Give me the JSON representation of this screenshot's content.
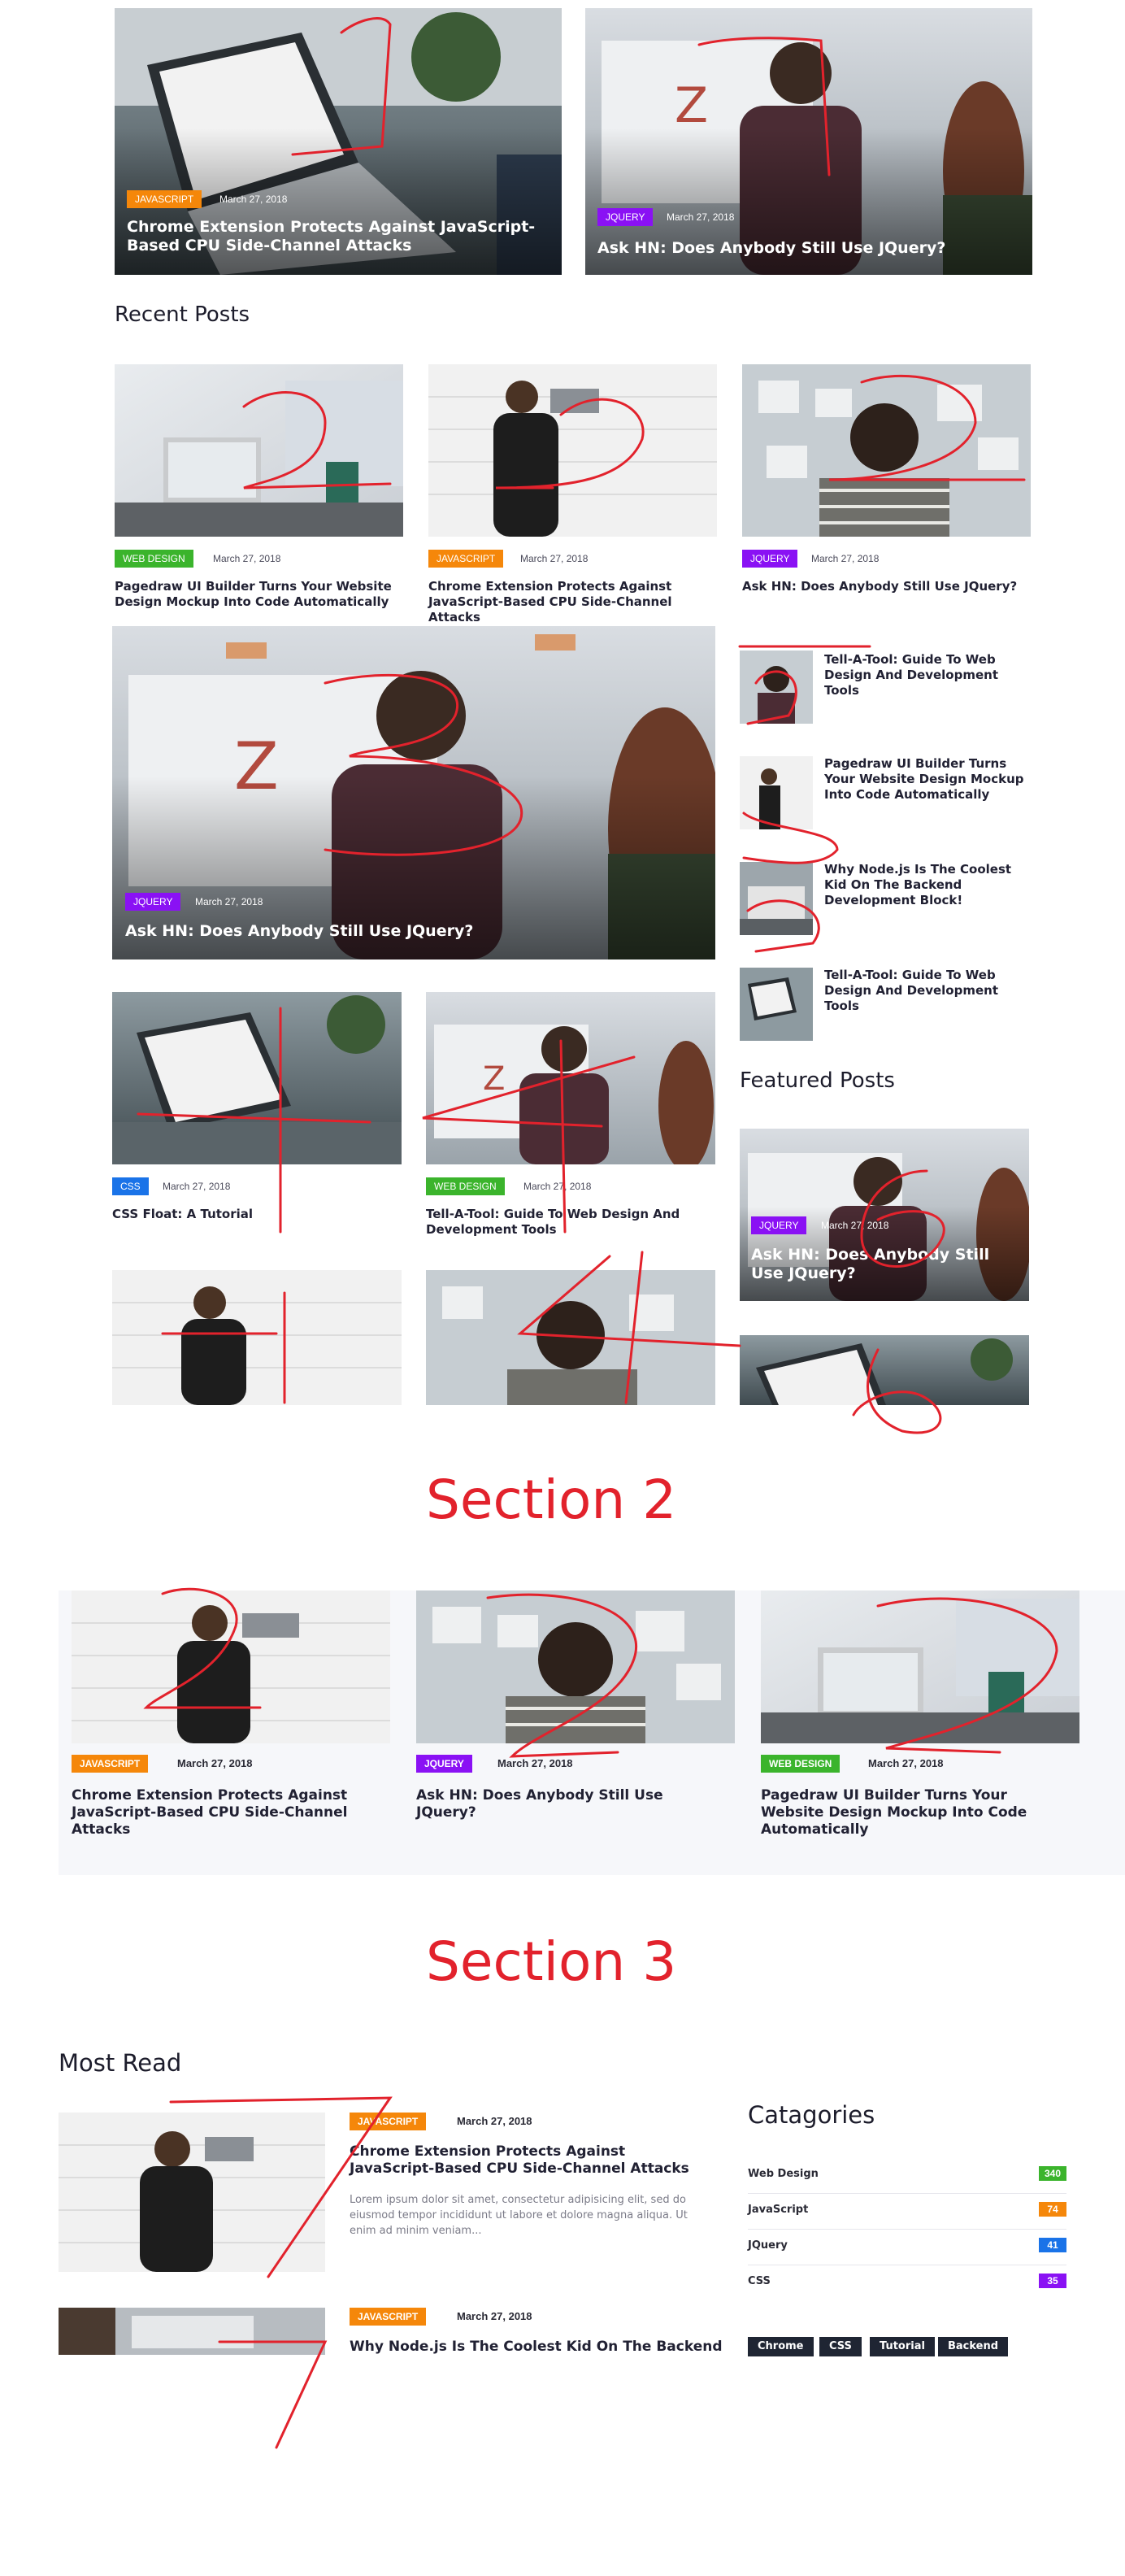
{
  "colors": {
    "javascript": "#f5870a",
    "jquery": "#8a11f4",
    "web_design": "#3bb42c",
    "css": "#1a73e8",
    "annotation": "#e2222c"
  },
  "hero": [
    {
      "category": "JAVASCRIPT",
      "date": "March 27, 2018",
      "title": "Chrome Extension Protects Against JavaScript-Based CPU Side-Channel Attacks"
    },
    {
      "category": "JQUERY",
      "date": "March 27, 2018",
      "title": "Ask HN: Does Anybody Still Use JQuery?"
    }
  ],
  "recent": {
    "heading": "Recent Posts",
    "top": [
      {
        "category": "WEB DESIGN",
        "date": "March 27, 2018",
        "title": "Pagedraw UI Builder Turns Your Website Design Mockup Into Code Automatically"
      },
      {
        "category": "JAVASCRIPT",
        "date": "March 27, 2018",
        "title": "Chrome Extension Protects Against JavaScript-Based CPU Side-Channel Attacks"
      },
      {
        "category": "JQUERY",
        "date": "March 27, 2018",
        "title": "Ask HN: Does Anybody Still Use JQuery?"
      }
    ],
    "big": {
      "category": "JQUERY",
      "date": "March 27, 2018",
      "title": "Ask HN: Does Anybody Still Use JQuery?"
    },
    "side": [
      {
        "title": "Tell-A-Tool: Guide To Web Design And Development Tools"
      },
      {
        "title": "Pagedraw UI Builder Turns Your Website Design Mockup Into Code Automatically"
      },
      {
        "title": "Why Node.js Is The Coolest Kid On The Backend Development Block!"
      },
      {
        "title": "Tell-A-Tool: Guide To Web Design And Development Tools"
      }
    ],
    "mid": [
      {
        "category": "CSS",
        "date": "March 27, 2018",
        "title": "CSS Float: A Tutorial"
      },
      {
        "category": "WEB DESIGN",
        "date": "March 27, 2018",
        "title": "Tell-A-Tool: Guide To Web Design And Development Tools"
      }
    ]
  },
  "featured": {
    "heading": "Featured Posts",
    "card": {
      "category": "JQUERY",
      "date": "March 27, 2018",
      "title": "Ask HN: Does Anybody Still Use JQuery?"
    }
  },
  "annotations": {
    "section2": "Section 2",
    "section3": "Section 3"
  },
  "section2": [
    {
      "category": "JAVASCRIPT",
      "date": "March 27, 2018",
      "title": "Chrome Extension Protects Against JavaScript-Based CPU Side-Channel Attacks"
    },
    {
      "category": "JQUERY",
      "date": "March 27, 2018",
      "title": "Ask HN: Does Anybody Still Use JQuery?"
    },
    {
      "category": "WEB DESIGN",
      "date": "March 27, 2018",
      "title": "Pagedraw UI Builder Turns Your Website Design Mockup Into Code Automatically"
    }
  ],
  "most_read": {
    "heading": "Most Read",
    "items": [
      {
        "category": "JAVASCRIPT",
        "date": "March 27, 2018",
        "title": "Chrome Extension Protects Against JavaScript-Based CPU Side-Channel Attacks",
        "excerpt": "Lorem ipsum dolor sit amet, consectetur adipisicing elit, sed do eiusmod tempor incididunt ut labore et dolore magna aliqua. Ut enim ad minim veniam..."
      },
      {
        "category": "JAVASCRIPT",
        "date": "March 27, 2018",
        "title": "Why Node.js Is The Coolest Kid On The Backend"
      }
    ]
  },
  "categories": {
    "heading": "Catagories",
    "items": [
      {
        "name": "Web Design",
        "count": "340",
        "color": "#3bb42c"
      },
      {
        "name": "JavaScript",
        "count": "74",
        "color": "#f5870a"
      },
      {
        "name": "JQuery",
        "count": "41",
        "color": "#1a73e8"
      },
      {
        "name": "CSS",
        "count": "35",
        "color": "#8a11f4"
      }
    ]
  },
  "tags": [
    "Chrome",
    "CSS",
    "Tutorial",
    "Backend"
  ]
}
